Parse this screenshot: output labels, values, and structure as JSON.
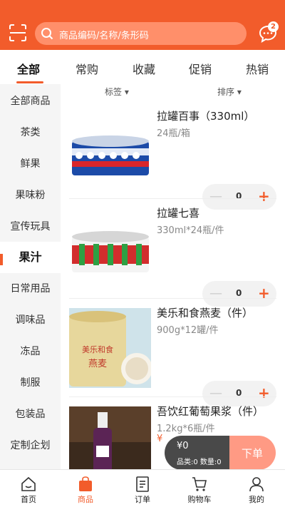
{
  "header": {
    "search_placeholder": "商品编码/名称/条形码",
    "message_badge": "2",
    "accent_color": "#f25c2b"
  },
  "tabs": [
    {
      "label": "全部",
      "active": true
    },
    {
      "label": "常购"
    },
    {
      "label": "收藏"
    },
    {
      "label": "促销"
    },
    {
      "label": "热销"
    }
  ],
  "filters": {
    "tag_label": "标签",
    "sort_label": "排序"
  },
  "sidebar": {
    "items": [
      {
        "label": "全部商品"
      },
      {
        "label": "茶类"
      },
      {
        "label": "鲜果"
      },
      {
        "label": "果味粉"
      },
      {
        "label": "宣传玩具"
      },
      {
        "label": "果汁",
        "active": true
      },
      {
        "label": "日常用品"
      },
      {
        "label": "调味品"
      },
      {
        "label": "冻品"
      },
      {
        "label": "制服"
      },
      {
        "label": "包装品"
      },
      {
        "label": "定制企划"
      }
    ]
  },
  "products": [
    {
      "name": "拉罐百事（330ml）",
      "spec": "24瓶/箱",
      "qty": "0"
    },
    {
      "name": "拉罐七喜",
      "spec": "330ml*24瓶/件",
      "qty": "0"
    },
    {
      "name": "美乐和食燕麦（件）",
      "spec": "900g*12罐/件",
      "qty": "0",
      "image_text_1": "美乐和食",
      "image_text_2": "燕麦"
    },
    {
      "name": "吾饮红葡萄果浆（件）",
      "spec": "1.2kg*6瓶/件",
      "price_hint": "¥"
    }
  ],
  "cart": {
    "price": "¥0",
    "info": "品类:0 数量:0",
    "order_label": "下单"
  },
  "bottom_nav": [
    {
      "label": "首页",
      "icon": "home-icon"
    },
    {
      "label": "商品",
      "icon": "shopping-bag-icon",
      "active": true
    },
    {
      "label": "订单",
      "icon": "order-list-icon"
    },
    {
      "label": "购物车",
      "icon": "cart-icon"
    },
    {
      "label": "我的",
      "icon": "user-icon"
    }
  ]
}
